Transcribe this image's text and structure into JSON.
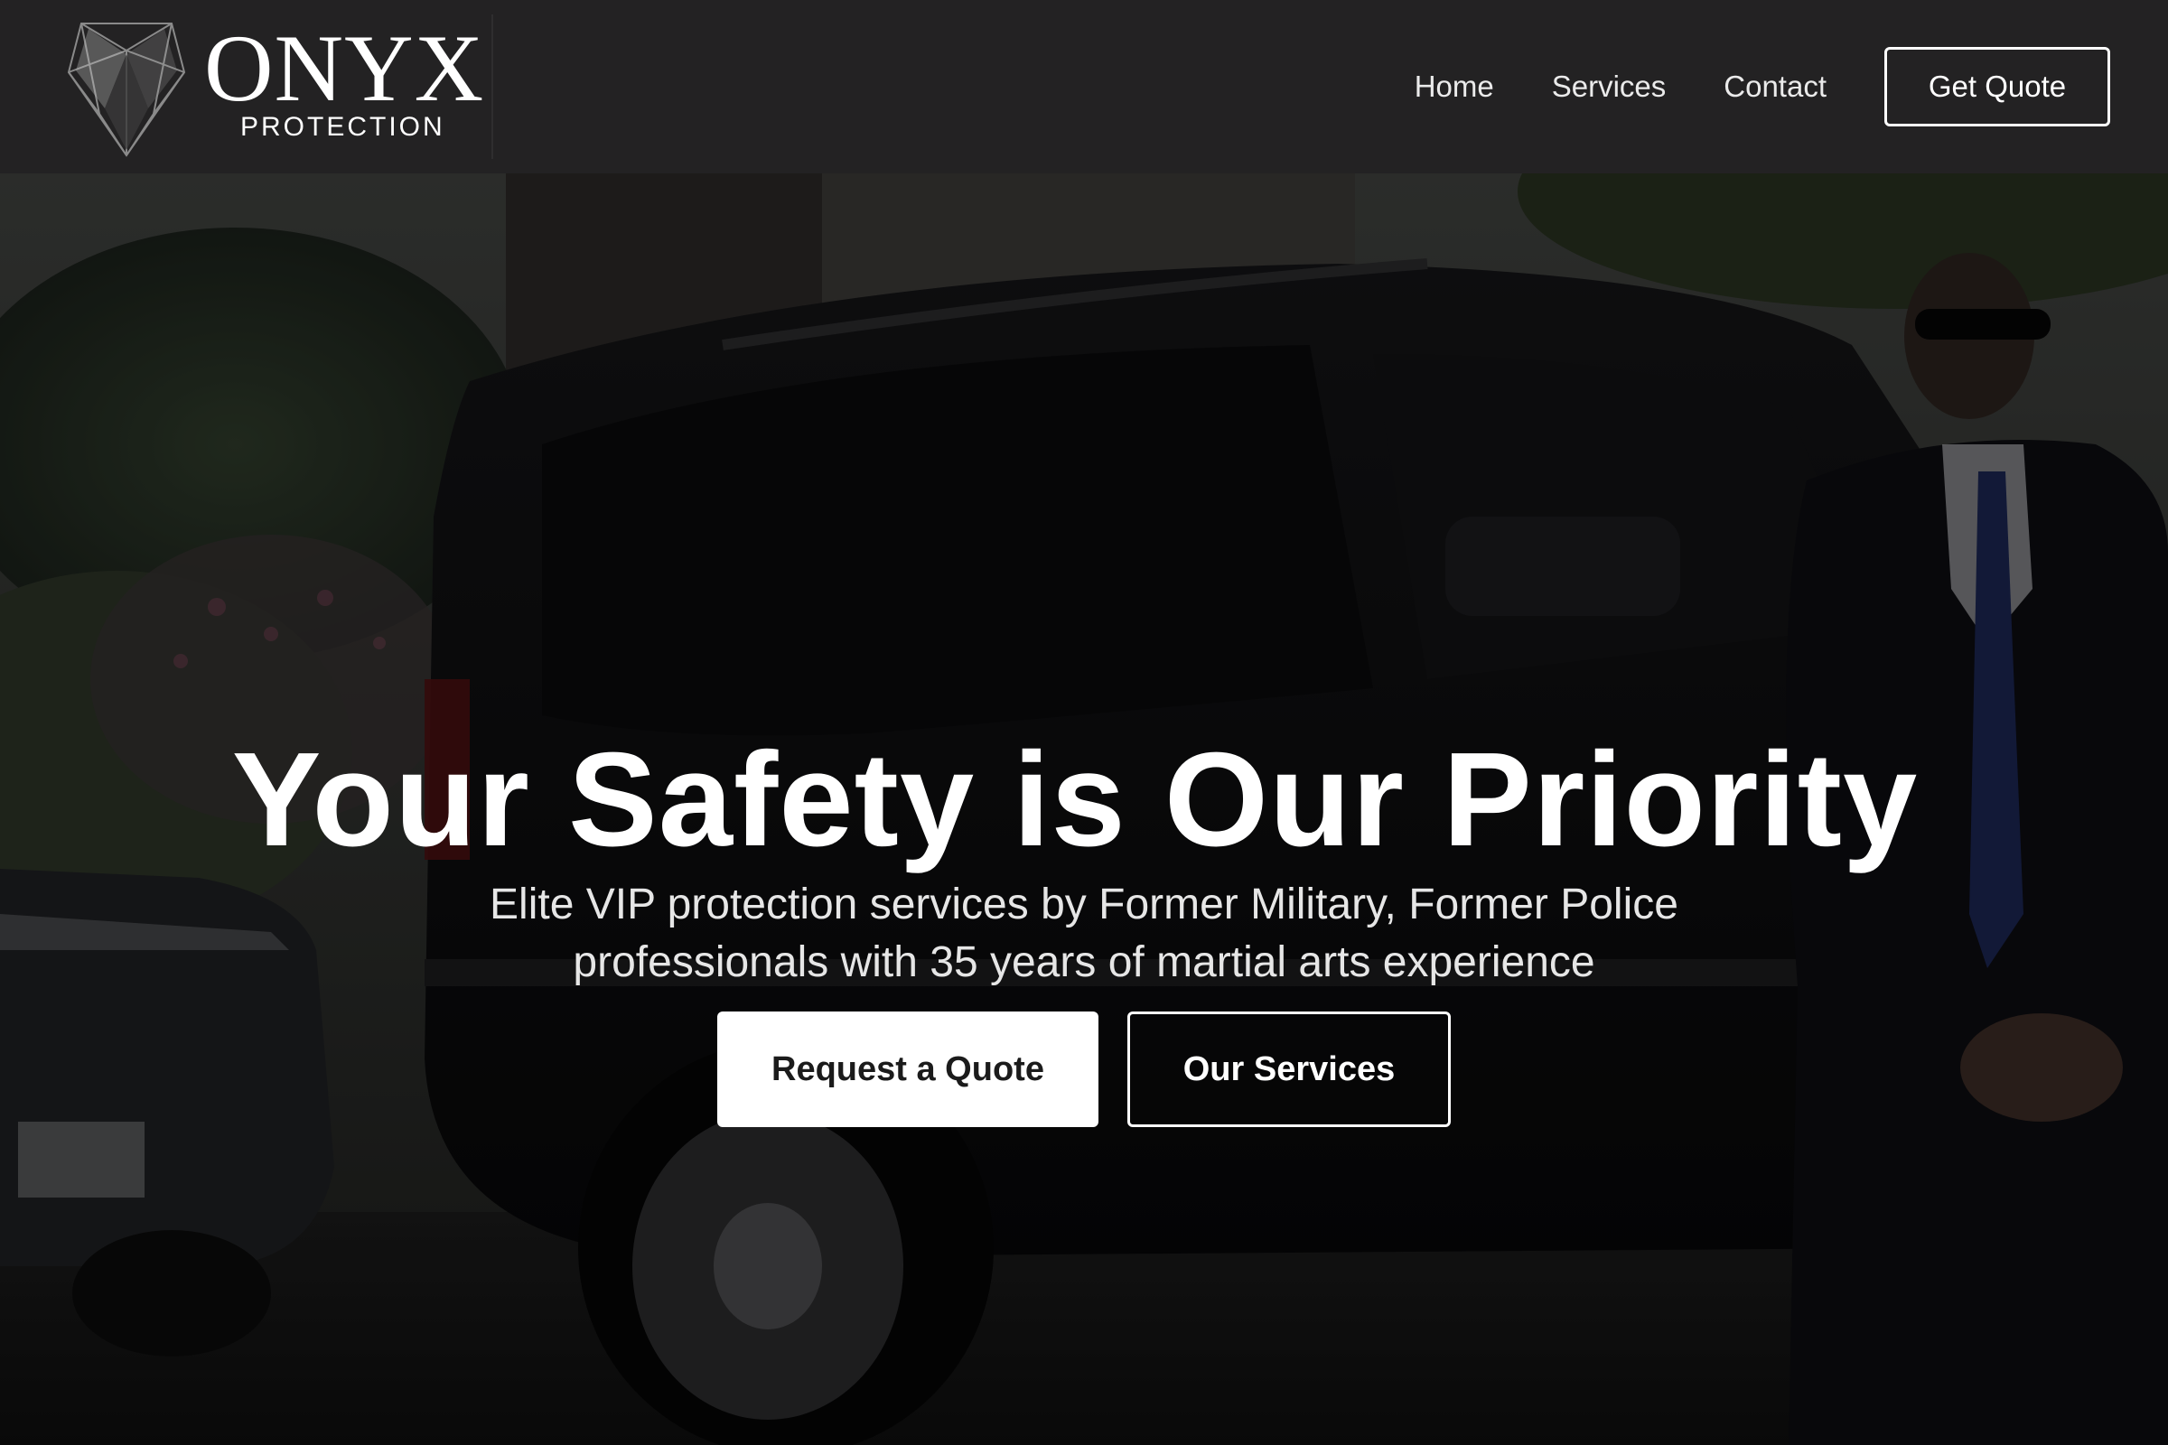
{
  "header": {
    "logo": {
      "wordmark": "ONYX",
      "tagline": "PROTECTION",
      "icon": "gem-shield-icon"
    },
    "nav": [
      {
        "label": "Home"
      },
      {
        "label": "Services"
      },
      {
        "label": "Contact"
      }
    ],
    "cta_label": "Get Quote"
  },
  "hero": {
    "title": "Your Safety is Our Priority",
    "subtitle": "Elite VIP protection services by Former Military, Former Police professionals with 35 years of martial arts experience",
    "primary_button": "Request a Quote",
    "secondary_button": "Our Services",
    "background_image": "bodyguard-beside-black-suv-photo"
  },
  "colors": {
    "header_bg": "#232223",
    "text": "#ffffff",
    "button_bg": "#ffffff",
    "button_text": "#1b1b1b"
  }
}
